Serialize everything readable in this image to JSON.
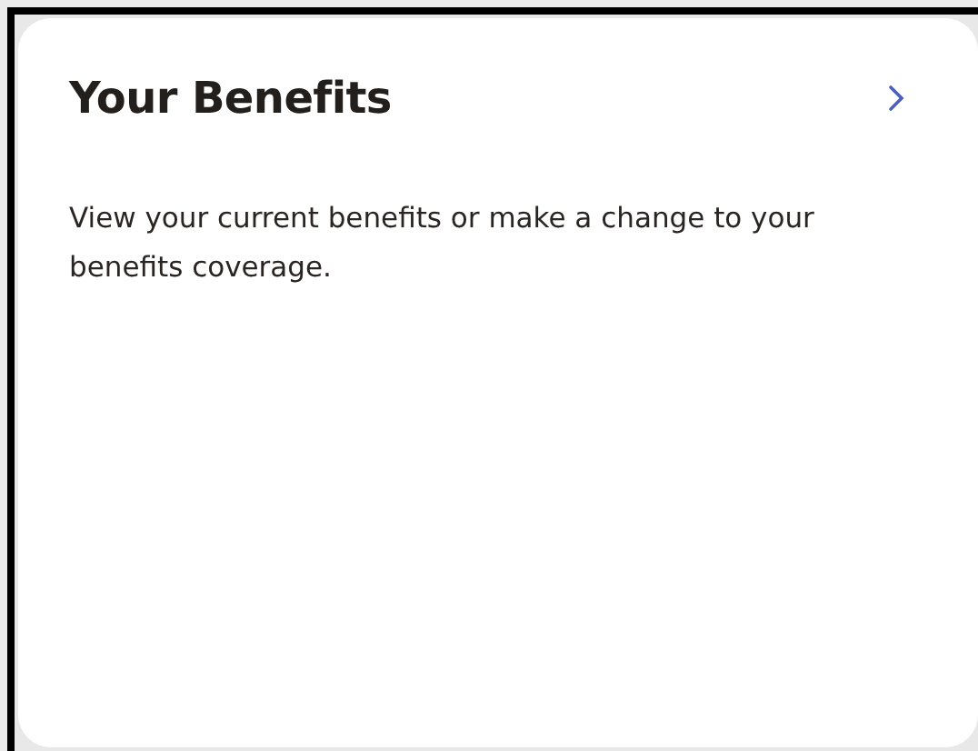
{
  "card": {
    "title": "Your Benefits",
    "description": "View your current benefits or make a change to your benefits coverage."
  }
}
